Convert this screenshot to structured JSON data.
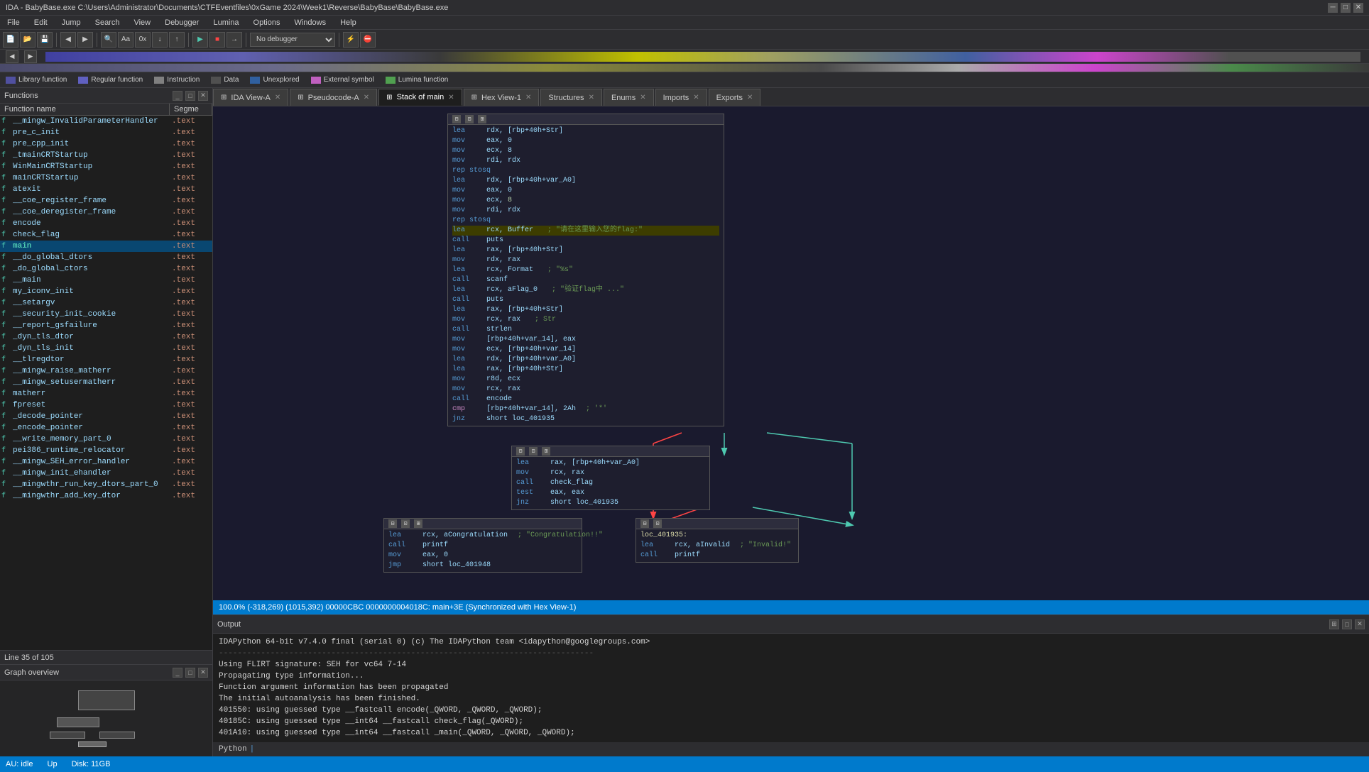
{
  "titlebar": {
    "title": "IDA - BabyBase.exe C:\\Users\\Administrator\\Documents\\CTFEventfiles\\0xGame 2024\\Week1\\Reverse\\BabyBase\\BabyBase.exe"
  },
  "menu": {
    "items": [
      "File",
      "Edit",
      "Jump",
      "Search",
      "View",
      "Debugger",
      "Lumina",
      "Options",
      "Windows",
      "Help"
    ]
  },
  "legend": {
    "items": [
      {
        "color": "#5050a0",
        "label": "Library function"
      },
      {
        "color": "#6060c0",
        "label": "Regular function"
      },
      {
        "color": "#808080",
        "label": "Instruction"
      },
      {
        "color": "#505050",
        "label": "Data"
      },
      {
        "color": "#3060a0",
        "label": "Unexplored"
      },
      {
        "color": "#c060c0",
        "label": "External symbol"
      },
      {
        "color": "#50a050",
        "label": "Lumina function"
      }
    ]
  },
  "tabs": {
    "items": [
      {
        "id": "ida-view",
        "label": "IDA View-A",
        "active": false,
        "closable": true
      },
      {
        "id": "pseudocode",
        "label": "Pseudocode-A",
        "active": false,
        "closable": true
      },
      {
        "id": "stack-main",
        "label": "Stack of main",
        "active": true,
        "closable": true
      },
      {
        "id": "hex-view",
        "label": "Hex View-1",
        "active": false,
        "closable": true
      },
      {
        "id": "structures",
        "label": "Structures",
        "active": false,
        "closable": true
      },
      {
        "id": "enums",
        "label": "Enums",
        "active": false,
        "closable": true
      },
      {
        "id": "imports",
        "label": "Imports",
        "active": false,
        "closable": true
      },
      {
        "id": "exports",
        "label": "Exports",
        "active": false,
        "closable": true
      }
    ]
  },
  "functions": {
    "title": "Functions",
    "columns": [
      "Function name",
      "Segme"
    ],
    "items": [
      {
        "name": "__mingw_InvalidParameterHandler",
        "seg": ".text",
        "bold": false
      },
      {
        "name": "pre_c_init",
        "seg": ".text",
        "bold": false
      },
      {
        "name": "pre_cpp_init",
        "seg": ".text",
        "bold": false
      },
      {
        "name": "_tmainCRTStartup",
        "seg": ".text",
        "bold": false
      },
      {
        "name": "WinMainCRTStartup",
        "seg": ".text",
        "bold": false
      },
      {
        "name": "mainCRTStartup",
        "seg": ".text",
        "bold": false
      },
      {
        "name": "atexit",
        "seg": ".text",
        "bold": false
      },
      {
        "name": "__coe_register_frame",
        "seg": ".text",
        "bold": false
      },
      {
        "name": "__coe_deregister_frame",
        "seg": ".text",
        "bold": false
      },
      {
        "name": "encode",
        "seg": ".text",
        "bold": false
      },
      {
        "name": "check_flag",
        "seg": ".text",
        "bold": false
      },
      {
        "name": "main",
        "seg": ".text",
        "bold": true
      },
      {
        "name": "__do_global_dtors",
        "seg": ".text",
        "bold": false
      },
      {
        "name": "_do_global_ctors",
        "seg": ".text",
        "bold": false
      },
      {
        "name": "__main",
        "seg": ".text",
        "bold": false
      },
      {
        "name": "my_iconv_init",
        "seg": ".text",
        "bold": false
      },
      {
        "name": "__setargv",
        "seg": ".text",
        "bold": false
      },
      {
        "name": "__security_init_cookie",
        "seg": ".text",
        "bold": false
      },
      {
        "name": "__report_gsfailure",
        "seg": ".text",
        "bold": false
      },
      {
        "name": "_dyn_tls_dtor",
        "seg": ".text",
        "bold": false
      },
      {
        "name": "_dyn_tls_init",
        "seg": ".text",
        "bold": false
      },
      {
        "name": "__tlregdtor",
        "seg": ".text",
        "bold": false
      },
      {
        "name": "__mingw_raise_matherr",
        "seg": ".text",
        "bold": false
      },
      {
        "name": "__mingw_setusermatherr",
        "seg": ".text",
        "bold": false
      },
      {
        "name": "matherr",
        "seg": ".text",
        "bold": false
      },
      {
        "name": "fpreset",
        "seg": ".text",
        "bold": false
      },
      {
        "name": "_decode_pointer",
        "seg": ".text",
        "bold": false
      },
      {
        "name": "_encode_pointer",
        "seg": ".text",
        "bold": false
      },
      {
        "name": "__write_memory_part_0",
        "seg": ".text",
        "bold": false
      },
      {
        "name": "pei386_runtime_relocator",
        "seg": ".text",
        "bold": false
      },
      {
        "name": "__mingw_SEH_error_handler",
        "seg": ".text",
        "bold": false
      },
      {
        "name": "__mingw_init_ehandler",
        "seg": ".text",
        "bold": false
      },
      {
        "name": "__mingwthr_run_key_dtors_part_0",
        "seg": ".text",
        "bold": false
      },
      {
        "name": "__mingwthr_add_key_dtor",
        "seg": ".text",
        "bold": false
      }
    ],
    "line_info": "Line 35 of 105"
  },
  "graph_overview": {
    "title": "Graph overview"
  },
  "asm_blocks": {
    "main_block": {
      "lines": [
        {
          "mnem": "lea",
          "op1": "rdx,",
          "op2": "[rbp+40h+Str]"
        },
        {
          "mnem": "mov",
          "op1": "eax,",
          "op2": "0"
        },
        {
          "mnem": "mov",
          "op1": "ecx,",
          "op2": "8"
        },
        {
          "mnem": "mov",
          "op1": "rdi,",
          "op2": "rdx"
        },
        {
          "mnem": "rep stosq",
          "op1": "",
          "op2": ""
        },
        {
          "mnem": "lea",
          "op1": "rdx,",
          "op2": "[rbp+40h+var_A0]"
        },
        {
          "mnem": "mov",
          "op1": "eax,",
          "op2": "0"
        },
        {
          "mnem": "mov",
          "op1": "ecx,",
          "op2": "8"
        },
        {
          "mnem": "mov",
          "op1": "rdi,",
          "op2": "rdx"
        },
        {
          "mnem": "rep stosq",
          "op1": "",
          "op2": ""
        },
        {
          "mnem": "lea",
          "op1": "rcx,",
          "op2": "Buffer",
          "comment": "; \"请在这里输入您的flag:\"",
          "highlight": true
        },
        {
          "mnem": "call",
          "op1": "puts",
          "op2": ""
        },
        {
          "mnem": "lea",
          "op1": "rax,",
          "op2": "[rbp+40h+Str]"
        },
        {
          "mnem": "mov",
          "op1": "rdx,",
          "op2": "rax"
        },
        {
          "mnem": "lea",
          "op1": "rcx,",
          "op2": "Format",
          "comment": "; \"%s\""
        },
        {
          "mnem": "call",
          "op1": "scanf",
          "op2": ""
        },
        {
          "mnem": "lea",
          "op1": "rcx,",
          "op2": "aFlag_0",
          "comment": "; \"验证flag中 ...\""
        },
        {
          "mnem": "call",
          "op1": "puts",
          "op2": ""
        },
        {
          "mnem": "lea",
          "op1": "rax,",
          "op2": "[rbp+40h+Str]"
        },
        {
          "mnem": "mov",
          "op1": "rcx,",
          "op2": "rax",
          "comment": "; Str"
        },
        {
          "mnem": "call",
          "op1": "strlen",
          "op2": ""
        },
        {
          "mnem": "mov",
          "op1": "[rbp+40h+var_14],",
          "op2": "eax"
        },
        {
          "mnem": "mov",
          "op1": "ecx,",
          "op2": "[rbp+40h+var_14]"
        },
        {
          "mnem": "lea",
          "op1": "rdx,",
          "op2": "[rbp+40h+var_A0]"
        },
        {
          "mnem": "lea",
          "op1": "rax,",
          "op2": "[rbp+40h+Str]"
        },
        {
          "mnem": "mov",
          "op1": "r8d,",
          "op2": "ecx"
        },
        {
          "mnem": "mov",
          "op1": "rcx,",
          "op2": "rax"
        },
        {
          "mnem": "call",
          "op1": "encode",
          "op2": ""
        },
        {
          "mnem": "cmp",
          "op1": "[rbp+40h+var_14],",
          "op2": "2Ah",
          "comment": "; '*'"
        },
        {
          "mnem": "jnz",
          "op1": "short loc_401935",
          "op2": ""
        }
      ]
    },
    "check_block": {
      "header": "loc_401935:",
      "lines": [
        {
          "mnem": "lea",
          "op1": "rax,",
          "op2": "[rbp+40h+var_A0]"
        },
        {
          "mnem": "mov",
          "op1": "rcx,",
          "op2": "rax"
        },
        {
          "mnem": "call",
          "op1": "check_flag",
          "op2": ""
        },
        {
          "mnem": "test",
          "op1": "eax,",
          "op2": "eax"
        },
        {
          "mnem": "jnz",
          "op1": "short loc_401935",
          "op2": ""
        }
      ]
    },
    "congrats_block": {
      "lines": [
        {
          "mnem": "lea",
          "op1": "rcx,",
          "op2": "aCongratulation",
          "comment": "; \"Congratulation!!\""
        },
        {
          "mnem": "call",
          "op1": "printf",
          "op2": ""
        },
        {
          "mnem": "mov",
          "op1": "eax,",
          "op2": "0"
        },
        {
          "mnem": "jmp",
          "op1": "short loc_401948",
          "op2": ""
        }
      ]
    },
    "invalid_block": {
      "header": "loc_401935:",
      "lines": [
        {
          "mnem": "lea",
          "op1": "rcx,",
          "op2": "aInvalid",
          "comment": "; \"Invalid!\""
        },
        {
          "mnem": "call",
          "op1": "printf",
          "op2": ""
        }
      ]
    }
  },
  "status_bar": {
    "text": "100.0%  (-318,269)  (1015,392)  00000CBC 0000000004018C: main+3E  (Synchronized with Hex View-1)"
  },
  "output": {
    "title": "Output",
    "lines": [
      "IDAPython 64-bit v7.4.0 final (serial 0) (c) The IDAPython team <idapython@googlegroups.com>",
      "-------------------------------------------------------------------------------",
      "Using FLIRT signature: SEH for vc64 7-14",
      "Propagating type information...",
      "Function argument information has been propagated",
      "The initial autoanalysis has been finished.",
      "401550: using guessed type __fastcall encode(_QWORD, _QWORD, _QWORD);",
      "40185C: using guessed type __int64 __fastcall check_flag(_QWORD);",
      "401A10: using guessed type __int64 __fastcall _main(_QWORD, _QWORD, _QWORD);"
    ],
    "python_label": "Python"
  },
  "bottom_status": {
    "au": "AU: idle",
    "up": "Up",
    "disk": "Disk: 11GB"
  },
  "debugger": {
    "label": "No debugger"
  }
}
